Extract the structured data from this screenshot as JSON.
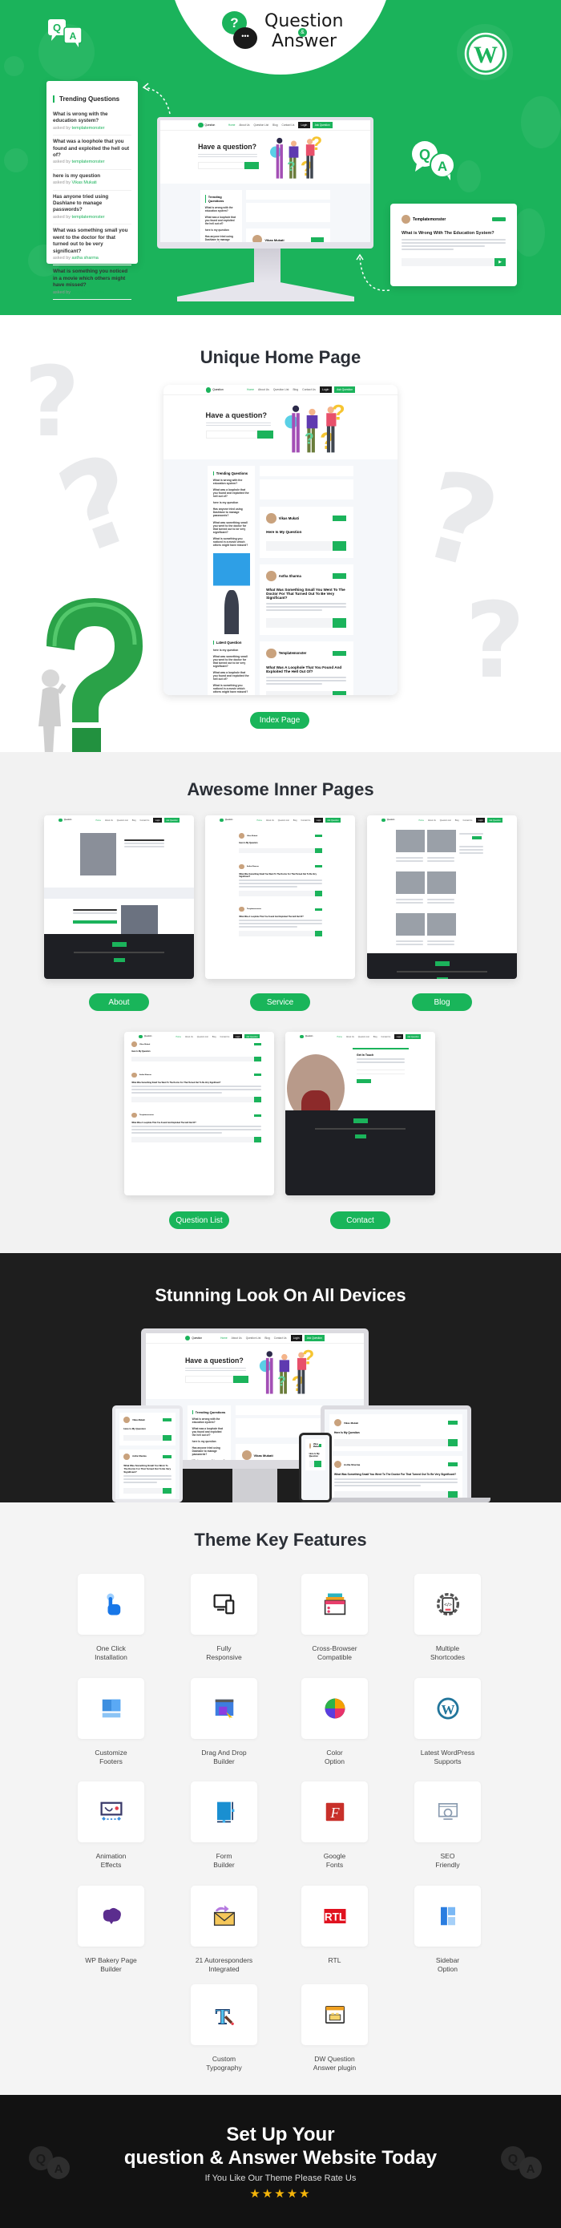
{
  "brand": {
    "question": "Question",
    "amp": "&",
    "answer": "Answer",
    "green": "#1bb35b",
    "dark": "#1e1e1e"
  },
  "hero": {
    "trending_card": {
      "title": "Trending Questions",
      "asked_by": "asked by",
      "items": [
        {
          "q": "What is wrong with the education system?",
          "author": "templatemonster"
        },
        {
          "q": "What was a loophole that you found and exploited the hell out of?",
          "author": "templatemonster"
        },
        {
          "q": "here is my question",
          "author": "Vikas Mukati"
        },
        {
          "q": "Has anyone tried using Dashlane to manage passwords?",
          "author": "templatemonster"
        },
        {
          "q": "What was something small you went to the doctor for that turned out to be very significant?",
          "author": "astha sharma"
        },
        {
          "q": "What is something you noticed in a movie which others might have missed?",
          "author": "templatemonster"
        }
      ]
    },
    "answer_card": {
      "author": "Templatemonster",
      "title": "What is Wrong With The Education System?"
    }
  },
  "site": {
    "nav": [
      "Home",
      "About Us",
      "Question List",
      "Blog",
      "Contact Us"
    ],
    "login": "Login",
    "ask": "Ask Question",
    "hero_title": "Have a question?",
    "trending": "Trending Questions",
    "latest": "Latest Question",
    "posts": [
      {
        "author": "Vikas Mukati",
        "title": "Here Is My Question"
      },
      {
        "author": "Astha Sharma",
        "title": "What Was Something Small You Went To The Doctor For That Turned Out To Be Very Significant?"
      },
      {
        "author": "Templatemonster",
        "title": "What Was A Loophole That You Found And Exploited The Hell Out Of?"
      }
    ]
  },
  "home_section": {
    "title": "Unique Home Page",
    "button": "Index Page"
  },
  "inner_section": {
    "title": "Awesome Inner Pages",
    "pages": [
      {
        "label": "About"
      },
      {
        "label": "Service"
      },
      {
        "label": "Blog"
      },
      {
        "label": "Question List"
      },
      {
        "label": "Contact"
      }
    ],
    "contact_heading": "Get In Touch"
  },
  "devices_section": {
    "title": "Stunning Look On All Devices"
  },
  "features": {
    "title": "Theme Key Features",
    "items": [
      {
        "label": [
          "One Click",
          "Installation"
        ],
        "icon": "pointer-hand-icon"
      },
      {
        "label": [
          "Fully",
          "Responsive"
        ],
        "icon": "responsive-devices-icon"
      },
      {
        "label": [
          "Cross-Browser",
          "Compatible"
        ],
        "icon": "browser-windows-icon"
      },
      {
        "label": [
          "Multiple",
          "Shortcodes"
        ],
        "icon": "code-gear-icon"
      },
      {
        "label": [
          "Customize",
          "Footers"
        ],
        "icon": "footer-layout-icon"
      },
      {
        "label": [
          "Drag And Drop",
          "Builder"
        ],
        "icon": "drag-drop-icon"
      },
      {
        "label": [
          "Color",
          "Option"
        ],
        "icon": "color-wheel-icon"
      },
      {
        "label": [
          "Latest WordPress",
          "Supports"
        ],
        "icon": "wordpress-icon"
      },
      {
        "label": [
          "Animation",
          "Effects"
        ],
        "icon": "animation-icon"
      },
      {
        "label": [
          "Form",
          "Builder"
        ],
        "icon": "form-builder-icon"
      },
      {
        "label": [
          "Google",
          "Fonts"
        ],
        "icon": "google-fonts-icon"
      },
      {
        "label": [
          "SEO",
          "Friendly"
        ],
        "icon": "seo-icon"
      },
      {
        "label": [
          "WP Bakery Page",
          "Builder"
        ],
        "icon": "wpbakery-icon"
      },
      {
        "label": [
          "21 Autoresponders",
          "Integrated"
        ],
        "icon": "envelope-icon"
      },
      {
        "label": [
          "RTL",
          ""
        ],
        "icon": "rtl-icon"
      },
      {
        "label": [
          "Sidebar",
          "Option"
        ],
        "icon": "sidebar-layout-icon"
      },
      {
        "label": [
          "Custom",
          "Typography"
        ],
        "icon": "typography-icon"
      },
      {
        "label": [
          "DW Question",
          "Answer plugin"
        ],
        "icon": "plugin-window-icon"
      }
    ]
  },
  "cta": {
    "line1": "Set Up Your",
    "line2": "question & Answer Website Today",
    "subtitle": "If You Like Our Theme Please Rate Us",
    "rating": 5,
    "star_color": "#f5b50a"
  }
}
